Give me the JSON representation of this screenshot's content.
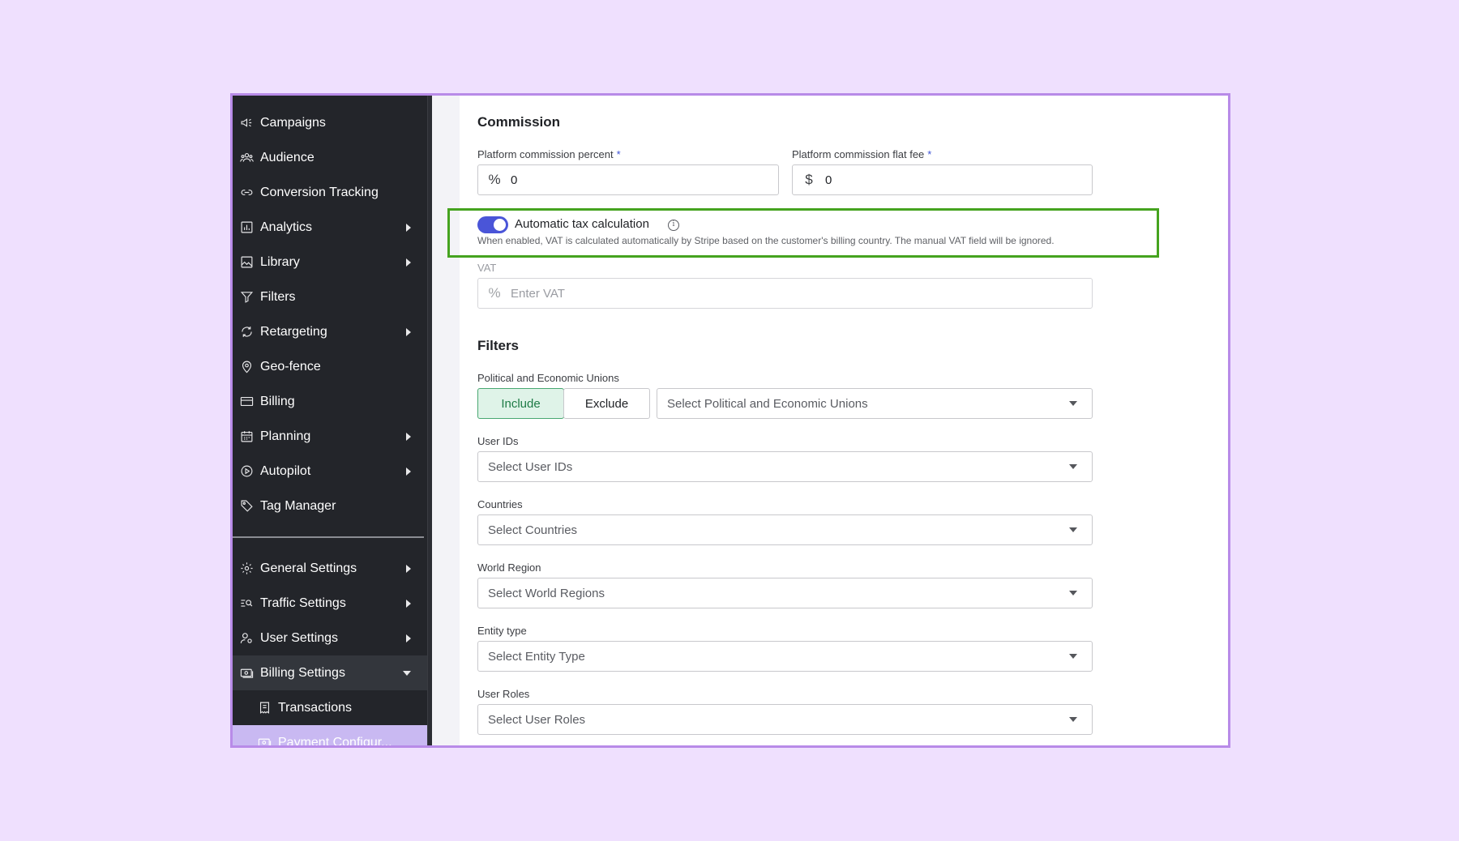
{
  "sidebar": {
    "items": [
      {
        "label": "Campaigns",
        "icon": "megaphone-icon",
        "has_children": false
      },
      {
        "label": "Audience",
        "icon": "users-icon",
        "has_children": false
      },
      {
        "label": "Conversion Tracking",
        "icon": "link-icon",
        "has_children": false
      },
      {
        "label": "Analytics",
        "icon": "bar-chart-icon",
        "has_children": true
      },
      {
        "label": "Library",
        "icon": "image-icon",
        "has_children": true
      },
      {
        "label": "Filters",
        "icon": "filter-icon",
        "has_children": false
      },
      {
        "label": "Retargeting",
        "icon": "refresh-icon",
        "has_children": true
      },
      {
        "label": "Geo-fence",
        "icon": "map-pin-icon",
        "has_children": false
      },
      {
        "label": "Billing",
        "icon": "credit-card-icon",
        "has_children": false
      },
      {
        "label": "Planning",
        "icon": "calendar-icon",
        "has_children": true
      },
      {
        "label": "Autopilot",
        "icon": "play-circle-icon",
        "has_children": true
      },
      {
        "label": "Tag Manager",
        "icon": "tag-icon",
        "has_children": false
      }
    ],
    "settings": [
      {
        "label": "General Settings",
        "icon": "gear-icon",
        "has_children": true
      },
      {
        "label": "Traffic Settings",
        "icon": "traffic-search-icon",
        "has_children": true
      },
      {
        "label": "User Settings",
        "icon": "user-settings-icon",
        "has_children": true
      },
      {
        "label": "Billing Settings",
        "icon": "money-icon",
        "has_children": true,
        "expanded": true
      }
    ],
    "sub_items": [
      {
        "label": "Transactions",
        "icon": "receipt-icon"
      },
      {
        "label": "Payment Configur...",
        "icon": "money-icon",
        "active": true
      }
    ]
  },
  "commission": {
    "title": "Commission",
    "percent_label": "Platform commission percent",
    "percent_prefix": "%",
    "percent_value": "0",
    "flat_label": "Platform commission flat fee",
    "flat_prefix": "$",
    "flat_value": "0",
    "required_mark": "*"
  },
  "tax": {
    "toggle_label": "Automatic tax calculation",
    "toggle_on": true,
    "info_glyph": "i",
    "help": "When enabled, VAT is calculated automatically by Stripe based on the customer's billing country. The manual VAT field will be ignored.",
    "vat_label": "VAT",
    "vat_prefix": "%",
    "vat_placeholder": "Enter VAT"
  },
  "filters": {
    "title": "Filters",
    "unions_label": "Political and Economic Unions",
    "include_label": "Include",
    "exclude_label": "Exclude",
    "unions_placeholder": "Select Political and Economic Unions",
    "user_ids_label": "User IDs",
    "user_ids_placeholder": "Select User IDs",
    "countries_label": "Countries",
    "countries_placeholder": "Select Countries",
    "region_label": "World Region",
    "region_placeholder": "Select World Regions",
    "entity_label": "Entity type",
    "entity_placeholder": "Select Entity Type",
    "roles_label": "User Roles",
    "roles_placeholder": "Select User Roles"
  },
  "colors": {
    "accent": "#4a55d8",
    "include_green": "#1d7a45",
    "highlight_border": "#45a31f",
    "sidebar_bg": "#23252a",
    "active_item": "#c9b9f2"
  }
}
